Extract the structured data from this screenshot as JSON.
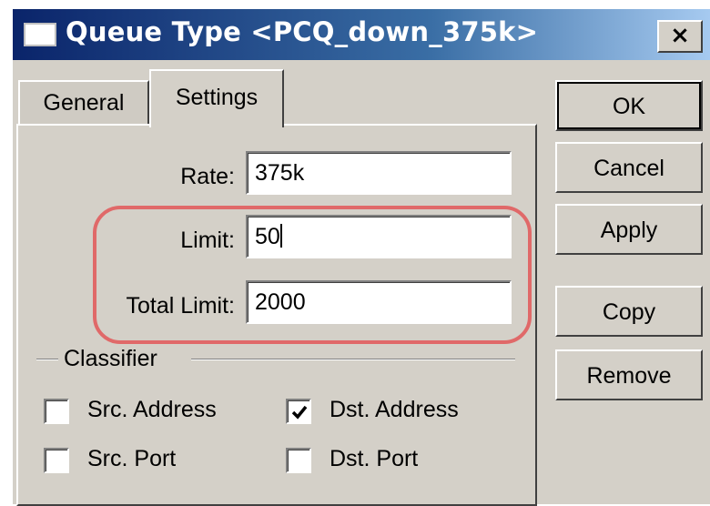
{
  "window": {
    "title": "Queue Type <PCQ_down_375k>",
    "close_glyph": "×"
  },
  "tabs": [
    {
      "label": "General",
      "active": false
    },
    {
      "label": "Settings",
      "active": true
    }
  ],
  "settings": {
    "rate_label": "Rate:",
    "rate_value": "375k",
    "limit_label": "Limit:",
    "limit_value": "50",
    "total_limit_label": "Total Limit:",
    "total_limit_value": "2000",
    "classifier_label": "Classifier",
    "classifier": {
      "src_address": {
        "label": "Src. Address",
        "checked": false
      },
      "dst_address": {
        "label": "Dst. Address",
        "checked": true
      },
      "src_port": {
        "label": "Src. Port",
        "checked": false
      },
      "dst_port": {
        "label": "Dst. Port",
        "checked": false
      }
    }
  },
  "buttons": {
    "ok": "OK",
    "cancel": "Cancel",
    "apply": "Apply",
    "copy": "Copy",
    "remove": "Remove"
  },
  "colors": {
    "title_gradient_start": "#0a246a",
    "title_gradient_end": "#a6caf0",
    "face": "#d4d0c8",
    "highlight": "#e06969"
  }
}
